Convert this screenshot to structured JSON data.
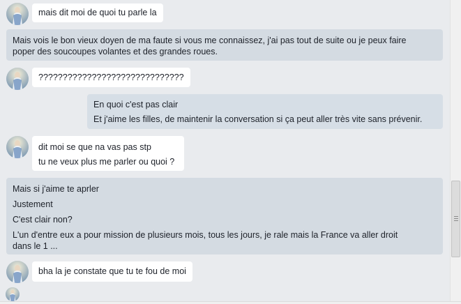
{
  "messages": [
    {
      "direction": "in",
      "avatar": "contact-avatar",
      "lines": [
        "mais  dit moi de quoi tu parle la"
      ]
    },
    {
      "direction": "out-full",
      "lines": [
        "Mais vois le bon vieux doyen de ma faute si vous me connaissez, j'ai pas tout de suite ou je peux faire",
        "poper des soucoupes volantes et des grandes roues."
      ]
    },
    {
      "direction": "in",
      "avatar": "contact-avatar",
      "lines": [
        "??????????????????????????????"
      ]
    },
    {
      "direction": "out",
      "lines": [
        "En quoi c'est pas clair",
        "Et j'aime les filles, de maintenir la conversation si ça peut aller très vite sans prévenir."
      ]
    },
    {
      "direction": "in",
      "avatar": "contact-avatar",
      "lines": [
        "dit moi se que na vas pas stp",
        "tu ne veux plus me parler ou quoi ?"
      ]
    },
    {
      "direction": "out-full",
      "lines": [
        "Mais si j'aime te aprler",
        "Justement",
        "C'est clair non?",
        "L'un d'entre eux a pour mission de plusieurs mois, tous les jours, je rale mais la France va aller droit",
        "dans le 1 ..."
      ]
    },
    {
      "direction": "in",
      "avatar": "contact-avatar",
      "lines": [
        "bha la je constate que tu te fou de moi"
      ]
    }
  ],
  "colors": {
    "background": "#e9ebee",
    "incoming": "#ffffff",
    "outgoing": "#d6dee6"
  }
}
